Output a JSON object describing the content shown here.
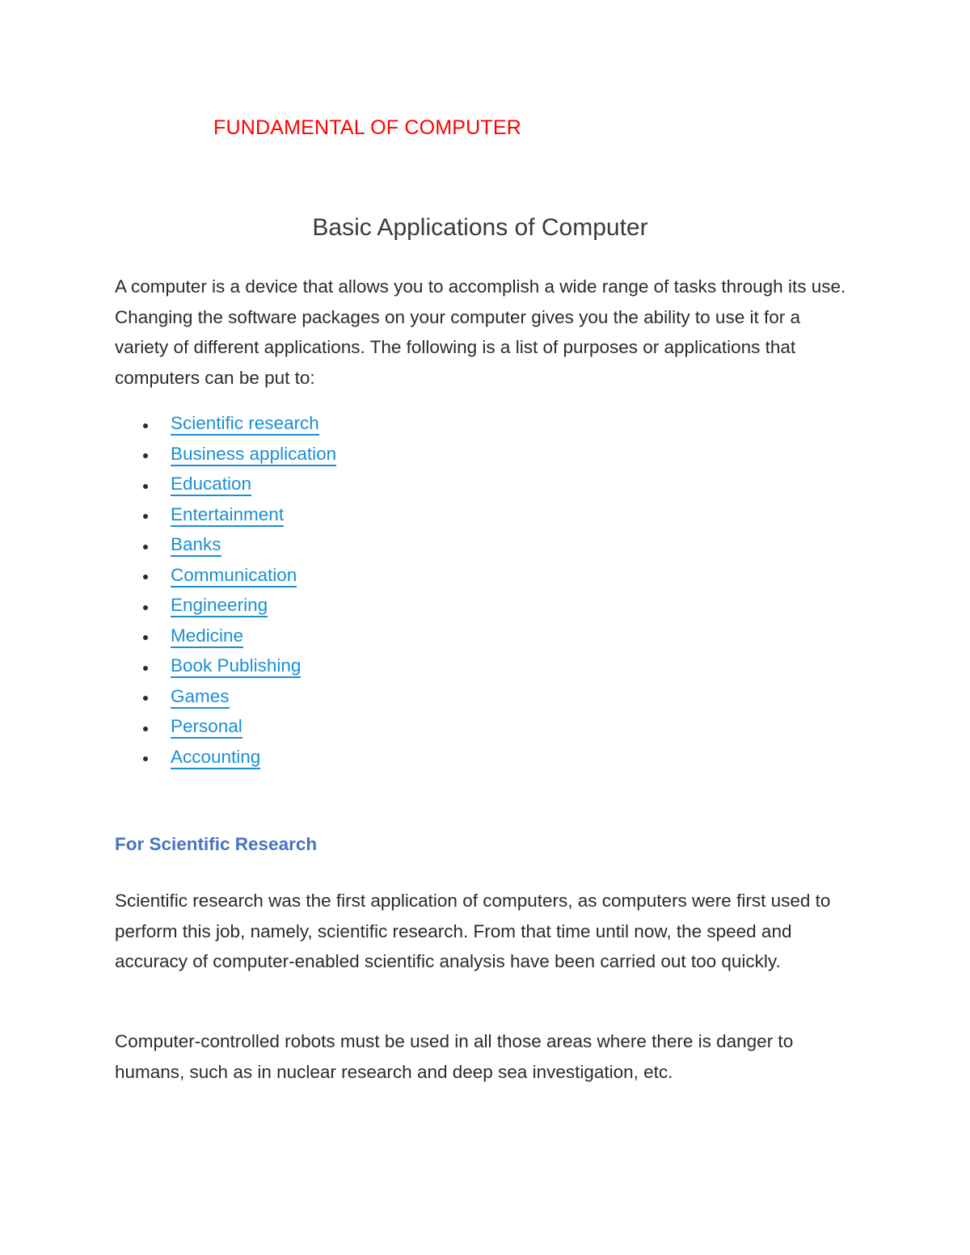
{
  "document": {
    "title_red": "FUNDAMENTAL OF COMPUTER",
    "main_heading": "Basic Applications of Computer",
    "intro_paragraph": "A computer is a device that allows you to accomplish a wide range of tasks through its use. Changing the software packages on your computer gives you the ability to use it for a variety of different applications. The following is a list of purposes or applications that computers can be put to:",
    "applications_list": [
      {
        "label": "Scientific research"
      },
      {
        "label": "Business application"
      },
      {
        "label": "Education"
      },
      {
        "label": "Entertainment"
      },
      {
        "label": "Banks"
      },
      {
        "label": "Communication"
      },
      {
        "label": "Engineering"
      },
      {
        "label": "Medicine"
      },
      {
        "label": "Book Publishing"
      },
      {
        "label": "Games"
      },
      {
        "label": "Personal"
      },
      {
        "label": "Accounting"
      }
    ],
    "section": {
      "heading": "For Scientific Research",
      "paragraph_1": "Scientific research was the first application of computers, as computers were first used to perform this job, namely, scientific research. From that time until now, the speed and accuracy of computer-enabled scientific analysis have been carried out too quickly.",
      "paragraph_2": "Computer-controlled robots must be used in all those areas where there is danger to humans, such as in nuclear research and deep sea investigation, etc."
    },
    "colors": {
      "title_red": "#ff0000",
      "link_blue": "#1b8fd1",
      "heading_blue": "#4574c4",
      "body_text": "#2b2b2b",
      "page_background": "#ffffff"
    }
  }
}
